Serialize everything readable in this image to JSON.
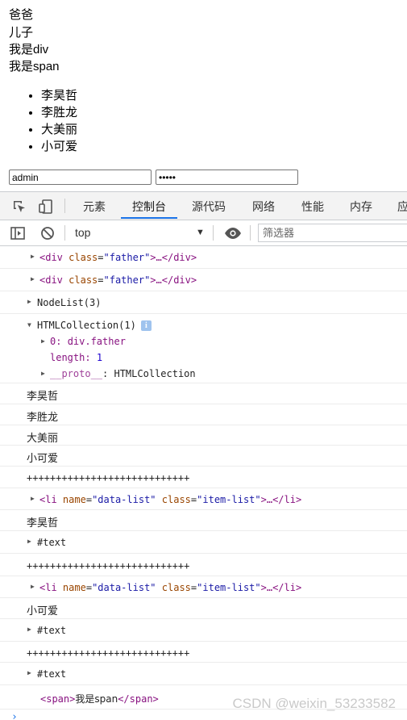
{
  "page": {
    "lines": [
      "爸爸",
      "儿子",
      "我是div",
      "我是span"
    ],
    "list_items": [
      "李昊哲",
      "李胜龙",
      "大美丽",
      "小可爱"
    ],
    "username_value": "admin",
    "password_value": "•••••"
  },
  "devtools": {
    "tabs": [
      "元素",
      "控制台",
      "源代码",
      "网络",
      "性能",
      "内存",
      "应"
    ],
    "active_tab": "控制台",
    "context": "top",
    "filter_placeholder": "筛选器"
  },
  "console": {
    "div_open_1": "<div",
    "div_class_attr": "class",
    "div_class_val": "\"father\"",
    "div_rest": ">…</div>",
    "nodelist": "NodeList(3)",
    "htmlcollection": "HTMLCollection(1)",
    "info_badge": "i",
    "coll_item_key": "0:",
    "coll_item_val": "div.father",
    "coll_length_key": "length:",
    "coll_length_val": "1",
    "coll_proto_key": "__proto__",
    "coll_proto_val": ": HTMLCollection",
    "log_names": [
      "李昊哲",
      "李胜龙",
      "大美丽",
      "小可爱"
    ],
    "plus_line_1": "++++++++++++++++++++++++++++",
    "plus_line_2": "++++++++++++++++++++++++++++",
    "plus_line_3": "++++++++++++++++++++++++++++",
    "li_open": "<li",
    "li_name_attr": "name",
    "li_name_val": "\"data-list\"",
    "li_class_attr": "class",
    "li_class_val": "\"item-list\"",
    "li_rest": ">…</li>",
    "first_li_text": "李昊哲",
    "text_node": "#text",
    "last_li_text": "小可爱",
    "span_open": "<span>",
    "span_text": "我是span",
    "span_close": "</span>",
    "prompt": "›"
  },
  "watermark": "CSDN @weixin_53233582",
  "colors": {
    "accent": "#1a73e8",
    "tag": "#881280",
    "attr_name": "#994500",
    "attr_value": "#1a1aa6"
  }
}
